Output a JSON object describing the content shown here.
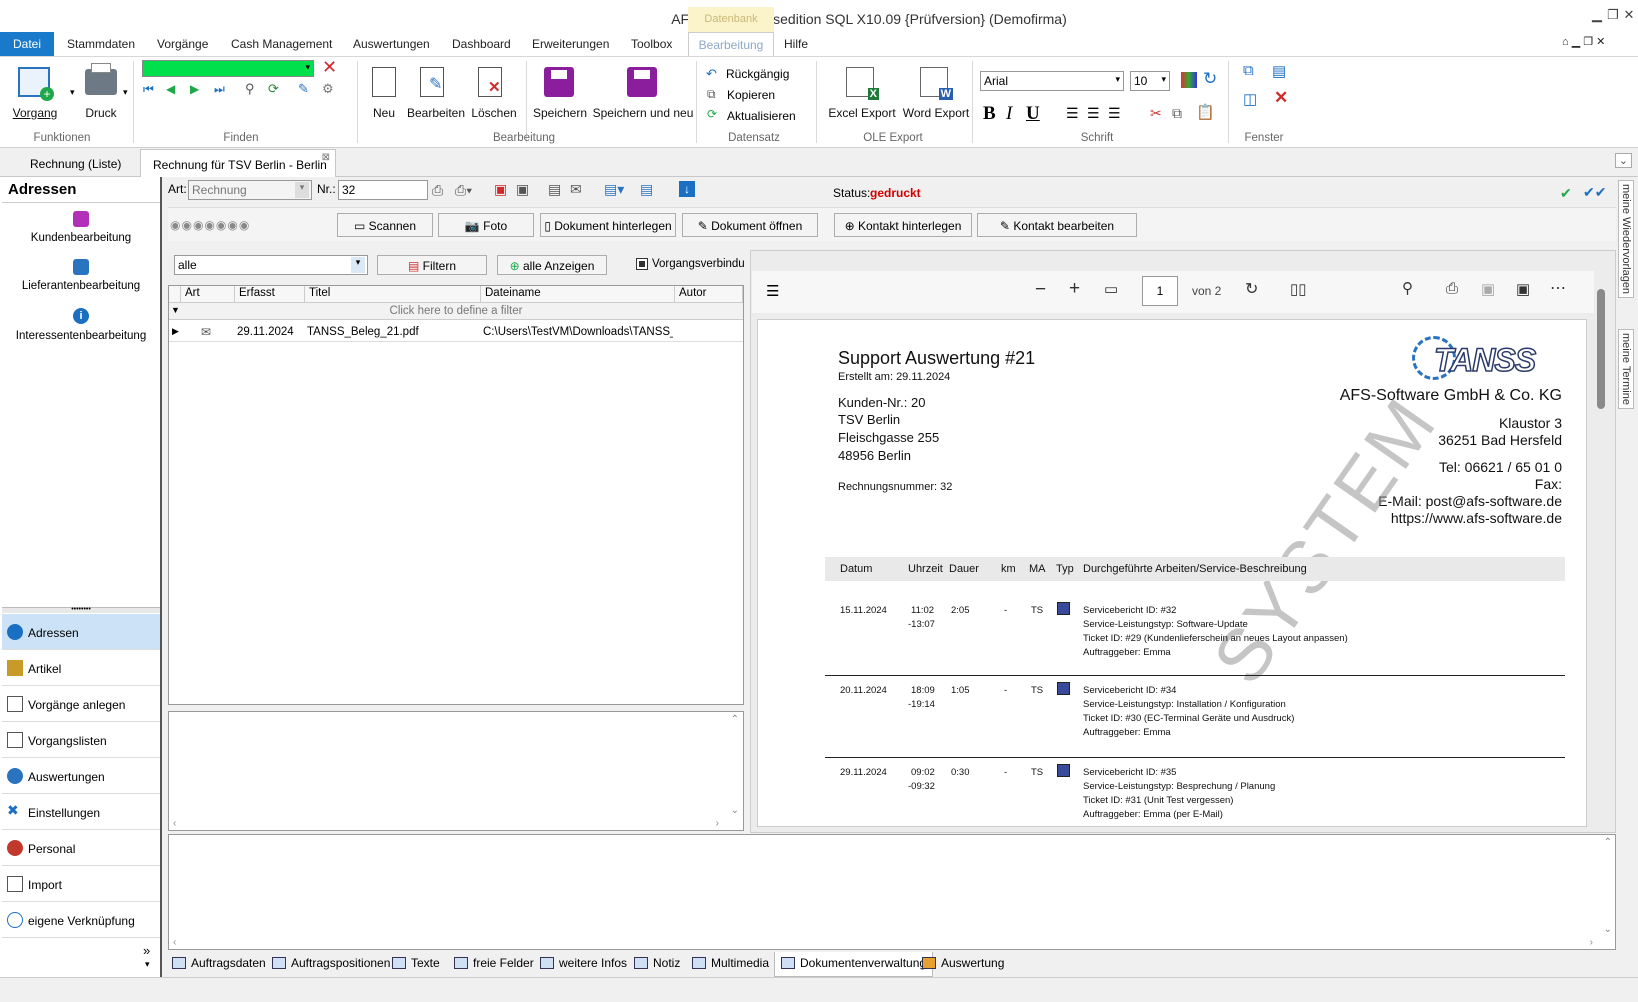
{
  "window": {
    "title": "AFS-Systemhausedition SQL   X10.09 {Prüfversion} (Demofirma)"
  },
  "ribbon_tabs": {
    "datei": "Datei",
    "stammdaten": "Stammdaten",
    "vorgaenge": "Vorgänge",
    "cash": "Cash Management",
    "auswertungen": "Auswertungen",
    "dashboard": "Dashboard",
    "erweiterungen": "Erweiterungen",
    "toolbox": "Toolbox",
    "context_header": "Datenbank",
    "bearbeitung": "Bearbeitung",
    "hilfe": "Hilfe"
  },
  "ribbon": {
    "vorgang": "Vorgang",
    "druck": "Druck",
    "funktionen": "Funktionen",
    "finden": "Finden",
    "neu": "Neu",
    "bearbeiten": "Bearbeiten",
    "loeschen": "Löschen",
    "bearbeitung": "Bearbeitung",
    "speichern": "Speichern",
    "speichern_neu": "Speichern und neu",
    "rueckgaengig": "Rückgängig",
    "kopieren": "Kopieren",
    "aktualisieren": "Aktualisieren",
    "datensatz": "Datensatz",
    "excel": "Excel Export",
    "word": "Word Export",
    "ole": "OLE Export",
    "font": "Arial",
    "size": "10",
    "schrift": "Schrift",
    "fenster": "Fenster",
    "bold": "B",
    "italic": "I",
    "underline": "U"
  },
  "doc_tabs": {
    "list": "Rechnung (Liste)",
    "current": "Rechnung für TSV Berlin - Berlin"
  },
  "left": {
    "title": "Adressen",
    "items": [
      "Kundenbearbeitung",
      "Lieferantenbearbeitung",
      "Interessentenbearbeitung"
    ],
    "nav": [
      "Adressen",
      "Artikel",
      "Vorgänge anlegen",
      "Vorgangslisten",
      "Auswertungen",
      "Einstellungen",
      "Personal",
      "Import",
      "eigene Verknüpfung"
    ],
    "more": "»"
  },
  "record": {
    "art_label": "Art:",
    "art_value": "Rechnung",
    "nr_label": "Nr.:",
    "nr_value": "32",
    "status_label": "Status:",
    "status_value": "gedruckt"
  },
  "actions": {
    "scannen": "Scannen",
    "foto": "Foto",
    "hinterlegen": "Dokument hinterlegen",
    "oeffnen": "Dokument öffnen",
    "kontakt_hinterlegen": "Kontakt hinterlegen",
    "kontakt_bearbeiten": "Kontakt bearbeiten"
  },
  "filter": {
    "select": "alle",
    "filtern": "Filtern",
    "alle_anzeigen": "alle Anzeigen",
    "vorgang": "Vorgangsverbindung"
  },
  "grid": {
    "headers": [
      "Art",
      "Erfasst",
      "Titel",
      "Dateiname",
      "Autor"
    ],
    "filter_hint": "Click here to define a filter",
    "rows": [
      {
        "erfasst": "29.11.2024",
        "titel": "TANSS_Beleg_21.pdf",
        "datei": "C:\\Users\\TestVM\\Downloads\\TANSS_Be"
      }
    ]
  },
  "pdf": {
    "page": "1",
    "of": "von 2",
    "title": "Support Auswertung #21",
    "created": "Erstellt am: 29.11.2024",
    "customer": [
      "Kunden-Nr.: 20",
      "TSV Berlin",
      "Fleischgasse 255",
      "48956 Berlin"
    ],
    "invoice": "Rechnungsnummer: 32",
    "company": "AFS-Software GmbH & Co. KG",
    "street": "Klaustor 3",
    "city": "36251 Bad Hersfeld",
    "tel": "Tel: 06621 / 65 01 0",
    "fax": "Fax:",
    "email": "E-Mail: post@afs-software.de",
    "web": "https://www.afs-software.de",
    "logo": "TANSS",
    "watermark": "SYSTEM",
    "columns": [
      "Datum",
      "Uhrzeit",
      "Dauer",
      "km",
      "MA",
      "Typ",
      "Durchgeführte Arbeiten/Service-Beschreibung"
    ],
    "entries": [
      {
        "date": "15.11.2024",
        "t1": "11:02",
        "t2": "-13:07",
        "dur": "2:05",
        "km": "-",
        "ma": "TS",
        "lines": [
          "Servicebericht ID: #32",
          "Service-Leistungstyp: Software-Update",
          "Ticket ID: #29 (Kundenlieferschein an neues Layout anpassen)",
          "Auftraggeber: Emma"
        ]
      },
      {
        "date": "20.11.2024",
        "t1": "18:09",
        "t2": "-19:14",
        "dur": "1:05",
        "km": "-",
        "ma": "TS",
        "lines": [
          "Servicebericht ID: #34",
          "Service-Leistungstyp: Installation / Konfiguration",
          "Ticket ID: #30 (EC-Terminal Geräte und Ausdruck)",
          "Auftraggeber: Emma"
        ]
      },
      {
        "date": "29.11.2024",
        "t1": "09:02",
        "t2": "-09:32",
        "dur": "0:30",
        "km": "-",
        "ma": "TS",
        "lines": [
          "Servicebericht ID: #35",
          "Service-Leistungstyp: Besprechung / Planung",
          "Ticket ID: #31 (Unit Test vergessen)",
          "Auftraggeber: Emma (per E-Mail)"
        ]
      }
    ]
  },
  "bottom_tabs": [
    "Auftragsdaten",
    "Auftragspositionen",
    "Texte",
    "freie Felder",
    "weitere Infos",
    "Notiz",
    "Multimedia",
    "Dokumentenverwaltung",
    "Auswertung"
  ],
  "right_strip": [
    "meine Wiedervorlagen",
    "meine Termine"
  ],
  "colors": {
    "accent": "#1979ca",
    "status": "#d00000",
    "green": "#00e04c",
    "purple": "#8a1e9c"
  }
}
